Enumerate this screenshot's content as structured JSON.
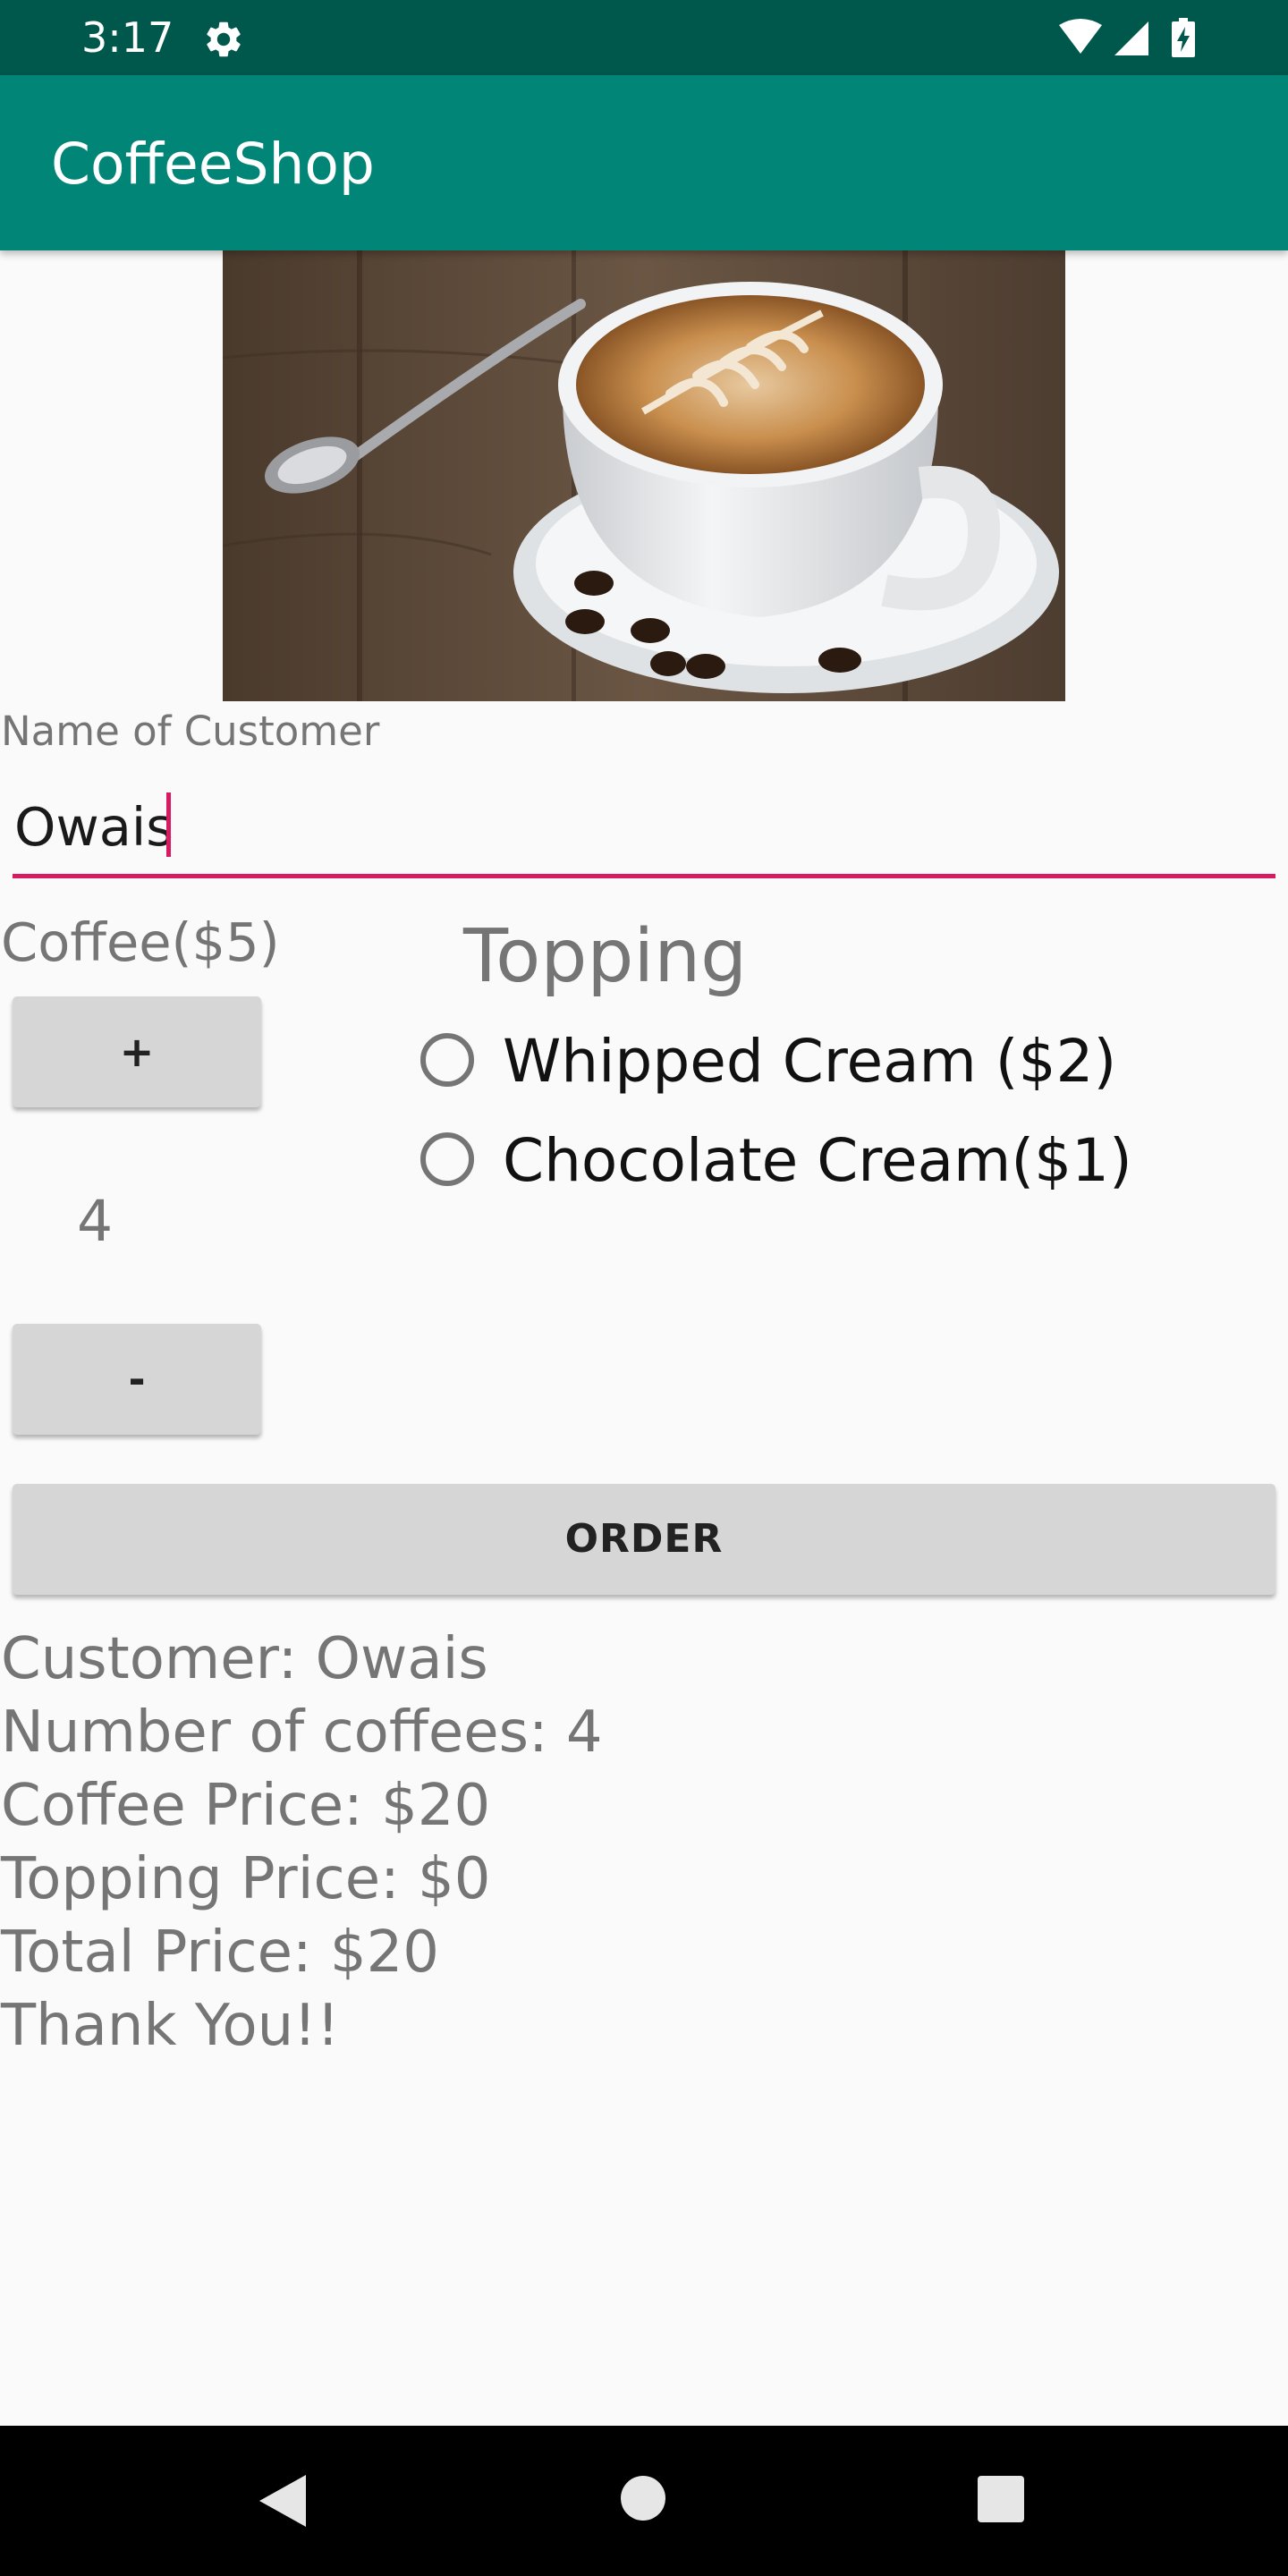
{
  "status_bar": {
    "time": "3:17",
    "icons": [
      "gear-icon",
      "wifi-icon",
      "signal-icon",
      "battery-charging-icon"
    ],
    "color": "#00574b"
  },
  "app_bar": {
    "title": "CoffeeShop",
    "color": "#008577"
  },
  "hero_image": {
    "description_icon": "coffee-cup-latte-art-image"
  },
  "form": {
    "name_label": "Name of Customer",
    "name_value": "Owais",
    "accent_color": "#d81b60"
  },
  "coffee": {
    "label": "Coffee($5)",
    "plus_label": "+",
    "minus_label": "-",
    "quantity": "4"
  },
  "topping": {
    "title": "Topping",
    "options": [
      {
        "label": "Whipped Cream ($2)",
        "selected": false
      },
      {
        "label": "Chocolate Cream($1)",
        "selected": false
      }
    ]
  },
  "order": {
    "button_label": "ORDER"
  },
  "summary": {
    "lines": [
      "Customer: Owais",
      "Number of coffees: 4",
      "Coffee Price: $20",
      "Topping Price: $0",
      "Total Price: $20",
      "Thank You!!"
    ]
  },
  "nav_bar": {
    "icons": [
      "back-icon",
      "home-icon",
      "recents-icon"
    ]
  }
}
